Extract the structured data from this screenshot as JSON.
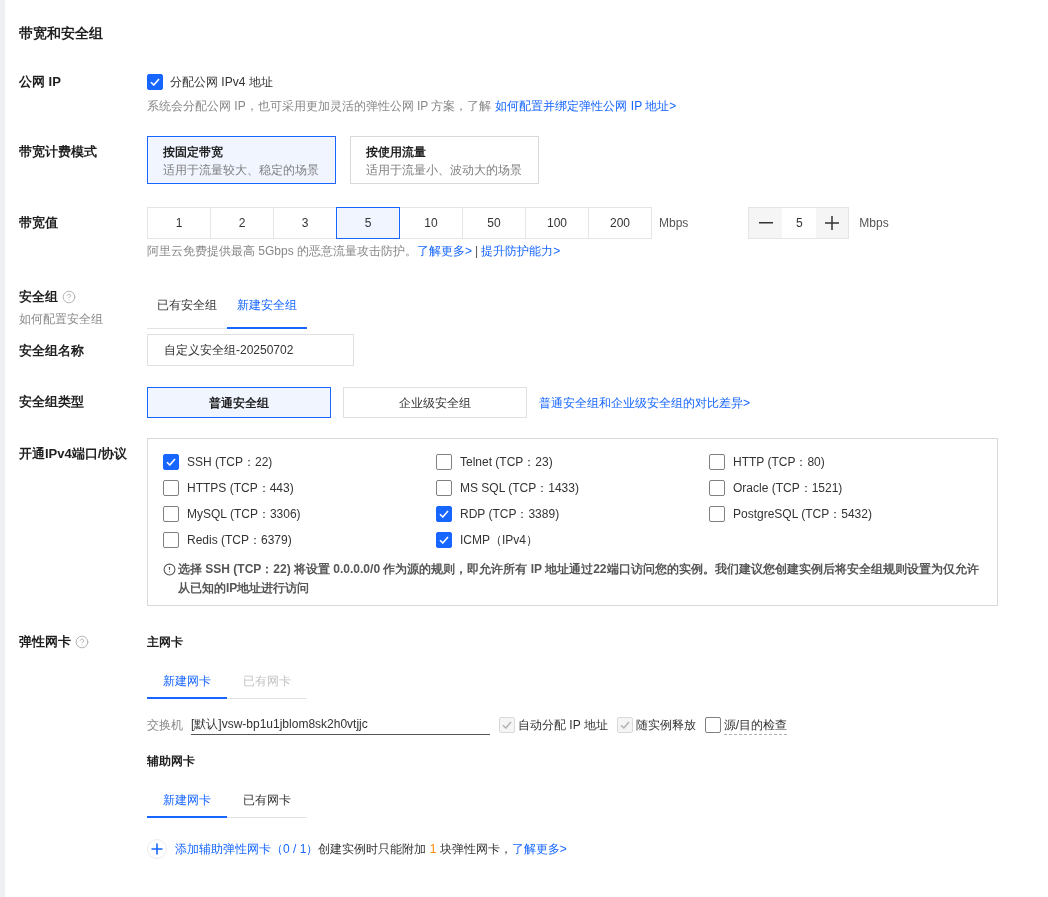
{
  "section_title": "带宽和安全组",
  "public_ip": {
    "label": "公网 IP",
    "checkbox": {
      "label": "分配公网 IPv4 地址",
      "checked": true
    },
    "hint": "系统会分配公网 IP，也可采用更加灵活的弹性公网 IP 方案，了解",
    "hint_link": "如何配置并绑定弹性公网 IP 地址>"
  },
  "billing_mode": {
    "label": "带宽计费模式",
    "options": [
      {
        "title": "按固定带宽",
        "description": "适用于流量较大、稳定的场景",
        "selected": true
      },
      {
        "title": "按使用流量",
        "description": "适用于流量小、波动大的场景",
        "selected": false
      }
    ]
  },
  "bandwidth": {
    "label": "带宽值",
    "options": [
      {
        "label": "1",
        "selected": false
      },
      {
        "label": "2",
        "selected": false
      },
      {
        "label": "3",
        "selected": false
      },
      {
        "label": "5",
        "selected": true
      },
      {
        "label": "10",
        "selected": false
      },
      {
        "label": "50",
        "selected": false
      },
      {
        "label": "100",
        "selected": false
      },
      {
        "label": "200",
        "selected": false
      }
    ],
    "unit": "Mbps",
    "stepper": {
      "value": "5",
      "unit": "Mbps"
    },
    "hint": "阿里云免费提供最高 5Gbps 的恶意流量攻击防护。",
    "links": [
      "了解更多>",
      "提升防护能力>"
    ],
    "separator": "|"
  },
  "security_group": {
    "label": "安全组",
    "sublabel": "如何配置安全组",
    "tabs": [
      {
        "label": "已有安全组",
        "selected": false
      },
      {
        "label": "新建安全组",
        "selected": true
      }
    ]
  },
  "security_group_name": {
    "label": "安全组名称",
    "value": "自定义安全组-20250702"
  },
  "security_group_type": {
    "label": "安全组类型",
    "options": [
      {
        "label": "普通安全组",
        "selected": true
      },
      {
        "label": "企业级安全组",
        "selected": false
      }
    ],
    "link": "普通安全组和企业级安全组的对比差异>"
  },
  "ports": {
    "label": "开通IPv4端口/协议",
    "items": [
      {
        "label": "SSH (TCP：22)",
        "checked": true
      },
      {
        "label": "Telnet (TCP：23)",
        "checked": false
      },
      {
        "label": "HTTP (TCP：80)",
        "checked": false
      },
      {
        "label": "HTTPS (TCP：443)",
        "checked": false
      },
      {
        "label": "MS SQL (TCP：1433)",
        "checked": false
      },
      {
        "label": "Oracle (TCP：1521)",
        "checked": false
      },
      {
        "label": "MySQL (TCP：3306)",
        "checked": false
      },
      {
        "label": "RDP (TCP：3389)",
        "checked": true
      },
      {
        "label": "PostgreSQL (TCP：5432)",
        "checked": false
      },
      {
        "label": "Redis (TCP：6379)",
        "checked": false
      },
      {
        "label": "ICMP（IPv4）",
        "checked": true
      }
    ],
    "note": "选择 SSH (TCP：22) 将设置 0.0.0.0/0 作为源的规则，即允许所有 IP 地址通过22端口访问您的实例。我们建议您创建实例后将安全组规则设置为仅允许从已知的IP地址进行访问"
  },
  "eni": {
    "label": "弹性网卡",
    "primary": {
      "title": "主网卡",
      "tabs": [
        {
          "label": "新建网卡",
          "selected": true,
          "disabled": false
        },
        {
          "label": "已有网卡",
          "selected": false,
          "disabled": true
        }
      ],
      "switch_label": "交换机",
      "switch_value": "[默认]vsw-bp1u1jblom8sk2h0vtjjc",
      "options": [
        {
          "label": "自动分配 IP 地址",
          "checked": true,
          "disabled": true,
          "has_tooltip": false
        },
        {
          "label": "随实例释放",
          "checked": true,
          "disabled": true,
          "has_tooltip": false
        },
        {
          "label": "源/目的检查",
          "checked": false,
          "disabled": false,
          "has_tooltip": true
        }
      ]
    },
    "secondary": {
      "title": "辅助网卡",
      "tabs": [
        {
          "label": "新建网卡",
          "selected": true
        },
        {
          "label": "已有网卡",
          "selected": false
        }
      ],
      "add_link": "添加辅助弹性网卡（0 / 1）",
      "limit_note": {
        "before": "创建实例时只能附加 ",
        "count": "1",
        "after": " 块弹性网卡，"
      },
      "learn_more": "了解更多>"
    }
  }
}
